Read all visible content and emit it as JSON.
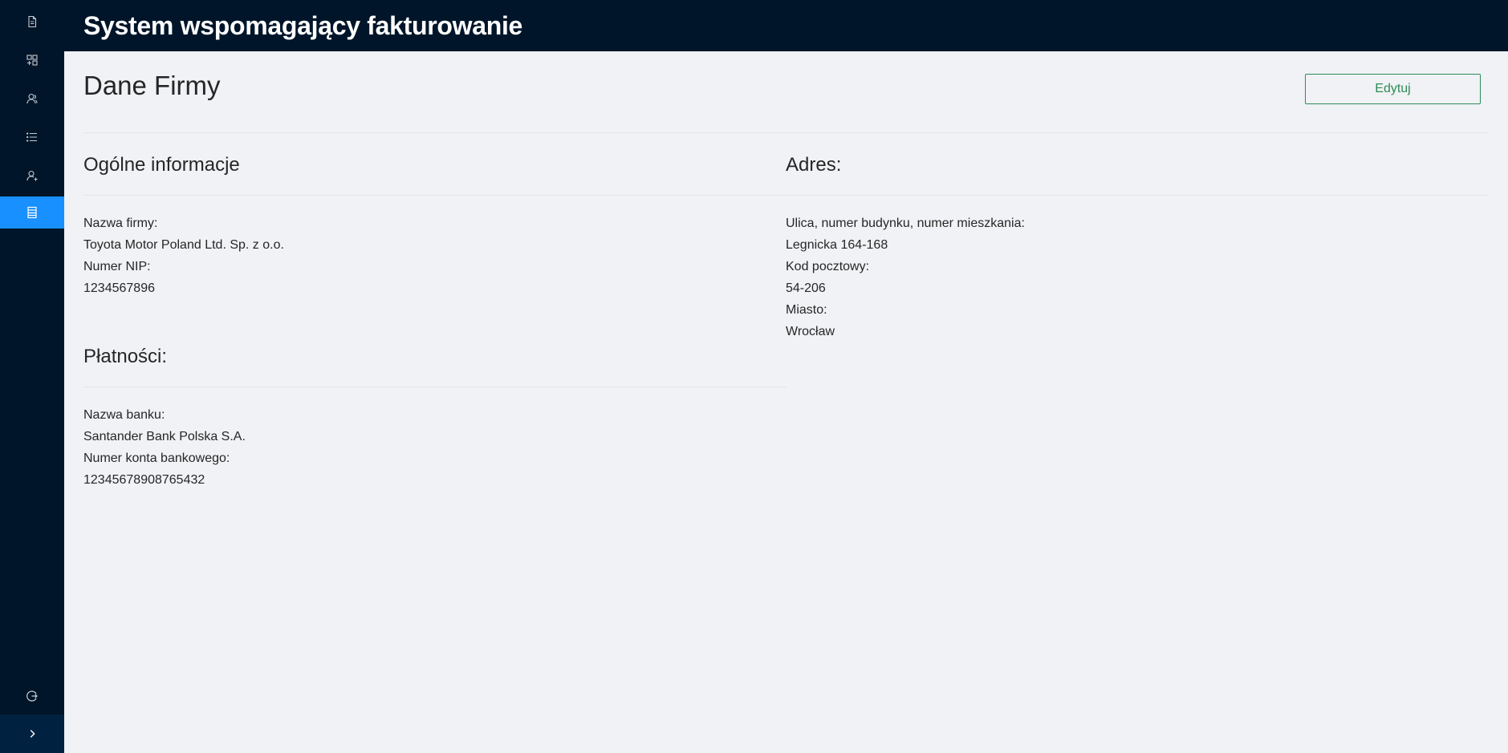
{
  "header": {
    "title": "System wspomagający fakturowanie"
  },
  "sidebar": {
    "items": [
      {
        "icon": "file-icon"
      },
      {
        "icon": "appstore-add-icon"
      },
      {
        "icon": "users-icon"
      },
      {
        "icon": "list-icon"
      },
      {
        "icon": "user-add-icon"
      },
      {
        "icon": "company-icon",
        "active": true
      }
    ],
    "logout_icon": "logout-icon",
    "collapse_icon": "chevron-right-icon"
  },
  "page": {
    "title": "Dane Firmy",
    "edit_label": "Edytuj"
  },
  "general": {
    "title": "Ogólne informacje",
    "company_name_label": "Nazwa firmy:",
    "company_name": "Toyota Motor Poland Ltd. Sp. z o.o.",
    "nip_label": "Numer NIP:",
    "nip": "1234567896"
  },
  "address": {
    "title": "Adres:",
    "street_label": "Ulica, numer budynku, numer mieszkania:",
    "street": "Legnicka 164-168",
    "postal_label": "Kod pocztowy:",
    "postal": "54-206",
    "city_label": "Miasto:",
    "city": "Wrocław"
  },
  "payments": {
    "title": "Płatności:",
    "bank_label": "Nazwa banku:",
    "bank": "Santander Bank Polska S.A.",
    "account_label": "Numer konta bankowego:",
    "account": "12345678908765432"
  },
  "colors": {
    "sidebar_bg": "#001529",
    "active_item": "#1890ff",
    "edit_button": "#2e8b57",
    "content_bg": "#f0f2f5"
  }
}
